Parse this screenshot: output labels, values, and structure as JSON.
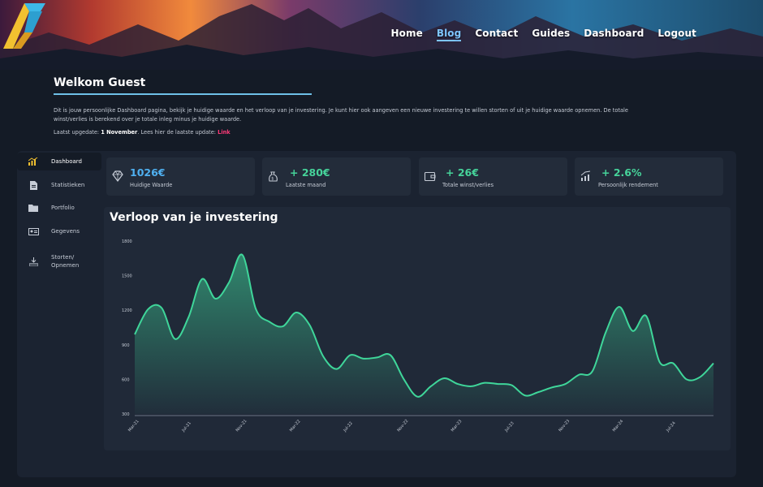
{
  "nav": {
    "items": [
      {
        "label": "Home",
        "active": false
      },
      {
        "label": "Blog",
        "active": true
      },
      {
        "label": "Contact",
        "active": false
      },
      {
        "label": "Guides",
        "active": false
      },
      {
        "label": "Dashboard",
        "active": false
      },
      {
        "label": "Logout",
        "active": false
      }
    ]
  },
  "welcome": {
    "title": "Welkom Guest",
    "intro": "Dit is jouw persoonlijke Dashboard pagina, bekijk je huidige waarde en het verloop van je investering. Je kunt hier ook aangeven een nieuwe investering te willen storten of uit je huidige waarde opnemen. De totale winst/verlies is berekend over je totale inleg minus je huidige waarde.",
    "update_prefix": "Laatst upgedate: ",
    "update_date": "1 November",
    "update_middle": ". Lees hier de laatste update: ",
    "update_link": "Link"
  },
  "sidebar": {
    "items": [
      {
        "label": "Dashboard",
        "icon": "bar-chart-icon",
        "active": true
      },
      {
        "label": "Statistieken",
        "icon": "document-icon",
        "active": false
      },
      {
        "label": "Portfolio",
        "icon": "folder-icon",
        "active": false
      },
      {
        "label": "Gegevens",
        "icon": "id-card-icon",
        "active": false
      },
      {
        "label": "Storten/",
        "label2": "Opnemen",
        "icon": "deposit-icon",
        "active": false
      }
    ]
  },
  "cards": [
    {
      "value": "1026€",
      "label": "Huidige Waarde",
      "icon": "diamond-icon",
      "color": "#4fb0f0"
    },
    {
      "value": "+ 280€",
      "label": "Laatste maand",
      "icon": "money-bag-icon",
      "color": "#46d39a"
    },
    {
      "value": "+ 26€",
      "label": "Totale winst/verlies",
      "icon": "wallet-icon",
      "color": "#46d39a"
    },
    {
      "value": "+ 2.6%",
      "label": "Persoonlijk rendement",
      "icon": "growth-chart-icon",
      "color": "#46d39a"
    }
  ],
  "chart_title": "Verloop van je investering",
  "colors": {
    "accent": "#6ec0e8",
    "line": "#3fd69a",
    "link": "#ff3a78",
    "background": "#141b26",
    "panel": "#1b2331"
  },
  "chart_data": {
    "type": "area",
    "title": "Verloop van je investering",
    "xlabel": "",
    "ylabel": "",
    "ylim": [
      300,
      1800
    ],
    "yticks": [
      300,
      600,
      900,
      1200,
      1500,
      1800
    ],
    "xticks": [
      "Mar-21",
      "Jul-21",
      "Nov-21",
      "Mar-22",
      "Jul-22",
      "Nov-22",
      "Mar-23",
      "Jul-23",
      "Nov-23",
      "Mar-24",
      "Jul-24"
    ],
    "x": [
      0,
      1,
      2,
      3,
      4,
      5,
      6,
      7,
      8,
      9,
      10,
      11,
      12,
      13,
      14,
      15,
      16,
      17,
      18,
      19,
      20,
      21,
      22,
      23,
      24,
      25,
      26,
      27,
      28,
      29,
      30,
      31,
      32,
      33,
      34,
      35,
      36,
      37,
      38,
      39,
      40,
      41,
      42,
      43
    ],
    "values": [
      990,
      1210,
      1220,
      950,
      1140,
      1470,
      1300,
      1440,
      1680,
      1210,
      1100,
      1060,
      1180,
      1070,
      800,
      690,
      810,
      780,
      790,
      810,
      600,
      450,
      540,
      610,
      560,
      540,
      570,
      560,
      550,
      460,
      490,
      530,
      560,
      640,
      670,
      1010,
      1230,
      1020,
      1150,
      750,
      740,
      600,
      620,
      740
    ],
    "grid": false,
    "legend": "none"
  }
}
